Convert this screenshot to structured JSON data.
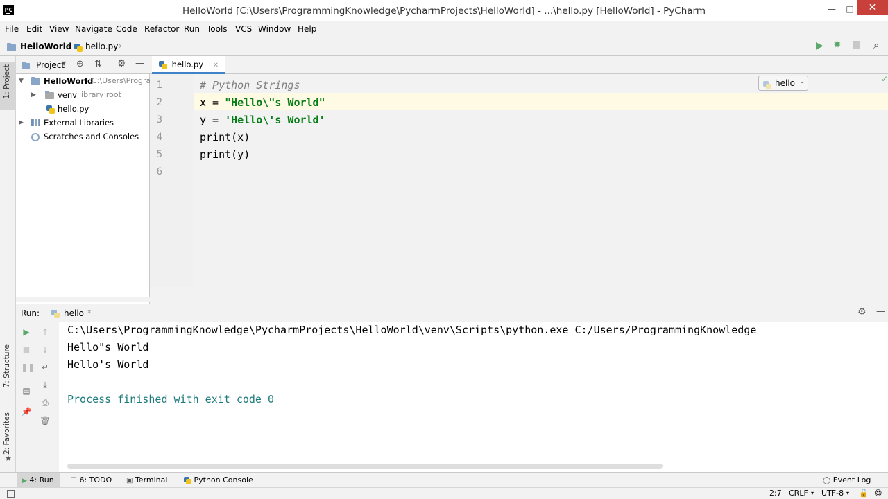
{
  "window": {
    "title": "HelloWorld [C:\\Users\\ProgrammingKnowledge\\PycharmProjects\\HelloWorld] - ...\\hello.py [HelloWorld] - PyCharm",
    "logo": "PC",
    "controls": {
      "minimize": "—",
      "maximize": "□",
      "close": "✕"
    }
  },
  "menu": [
    "File",
    "Edit",
    "View",
    "Navigate",
    "Code",
    "Refactor",
    "Run",
    "Tools",
    "VCS",
    "Window",
    "Help"
  ],
  "navbar": {
    "breadcrumb": [
      "HelloWorld",
      "hello.py"
    ],
    "run_config": "hello"
  },
  "left_stripe": {
    "project_tab": "1: Project",
    "structure_tab": "7: Structure",
    "favorites_tab": "2: Favorites"
  },
  "project_panel": {
    "title": "Project",
    "tree": [
      {
        "label": "HelloWorld",
        "hint": "C:\\Users\\Progra",
        "type": "folder",
        "expanded": true
      },
      {
        "label": "venv",
        "hint": "library root",
        "type": "folder",
        "expanded": false
      },
      {
        "label": "hello.py",
        "hint": "",
        "type": "python-file"
      },
      {
        "label": "External Libraries",
        "hint": "",
        "type": "libraries",
        "expanded": false
      },
      {
        "label": "Scratches and Consoles",
        "hint": "",
        "type": "scratches"
      }
    ]
  },
  "editor": {
    "tab": "hello.py",
    "caret_line": 2,
    "lines": [
      {
        "n": "1",
        "parts": [
          {
            "t": "# Python Strings",
            "c": "cmt"
          }
        ]
      },
      {
        "n": "2",
        "parts": [
          {
            "t": "x = ",
            "c": ""
          },
          {
            "t": "\"Hello\\\"s World\"",
            "c": "str"
          }
        ]
      },
      {
        "n": "3",
        "parts": [
          {
            "t": "y = ",
            "c": ""
          },
          {
            "t": "'Hello\\'s World'",
            "c": "str"
          }
        ]
      },
      {
        "n": "4",
        "parts": [
          {
            "t": "print(x)",
            "c": ""
          }
        ]
      },
      {
        "n": "5",
        "parts": [
          {
            "t": "print(y)",
            "c": ""
          }
        ]
      },
      {
        "n": "6",
        "parts": []
      }
    ]
  },
  "run_panel": {
    "label": "Run:",
    "tab": "hello",
    "output": [
      {
        "text": "C:\\Users\\ProgrammingKnowledge\\PycharmProjects\\HelloWorld\\venv\\Scripts\\python.exe C:/Users/ProgrammingKnowledge",
        "color": "#000000"
      },
      {
        "text": "Hello\"s World",
        "color": "#000000"
      },
      {
        "text": "Hello's World",
        "color": "#000000"
      },
      {
        "text": "",
        "color": "#000000"
      },
      {
        "text": "Process finished with exit code 0",
        "color": "#1e7b7b"
      }
    ]
  },
  "bottom_tabs": [
    {
      "label": "4: Run",
      "icon": "run-icon"
    },
    {
      "label": "6: TODO",
      "icon": "todo-icon"
    },
    {
      "label": "Terminal",
      "icon": "terminal-icon"
    },
    {
      "label": "Python Console",
      "icon": "python-console-icon"
    }
  ],
  "event_log": "Event Log",
  "status": {
    "position": "2:7",
    "line_sep": "CRLF",
    "encoding": "UTF-8"
  },
  "colors": {
    "accent": "#4083c9",
    "run_green": "#59a869",
    "close_red": "#c7413a",
    "string": "#067d17"
  }
}
